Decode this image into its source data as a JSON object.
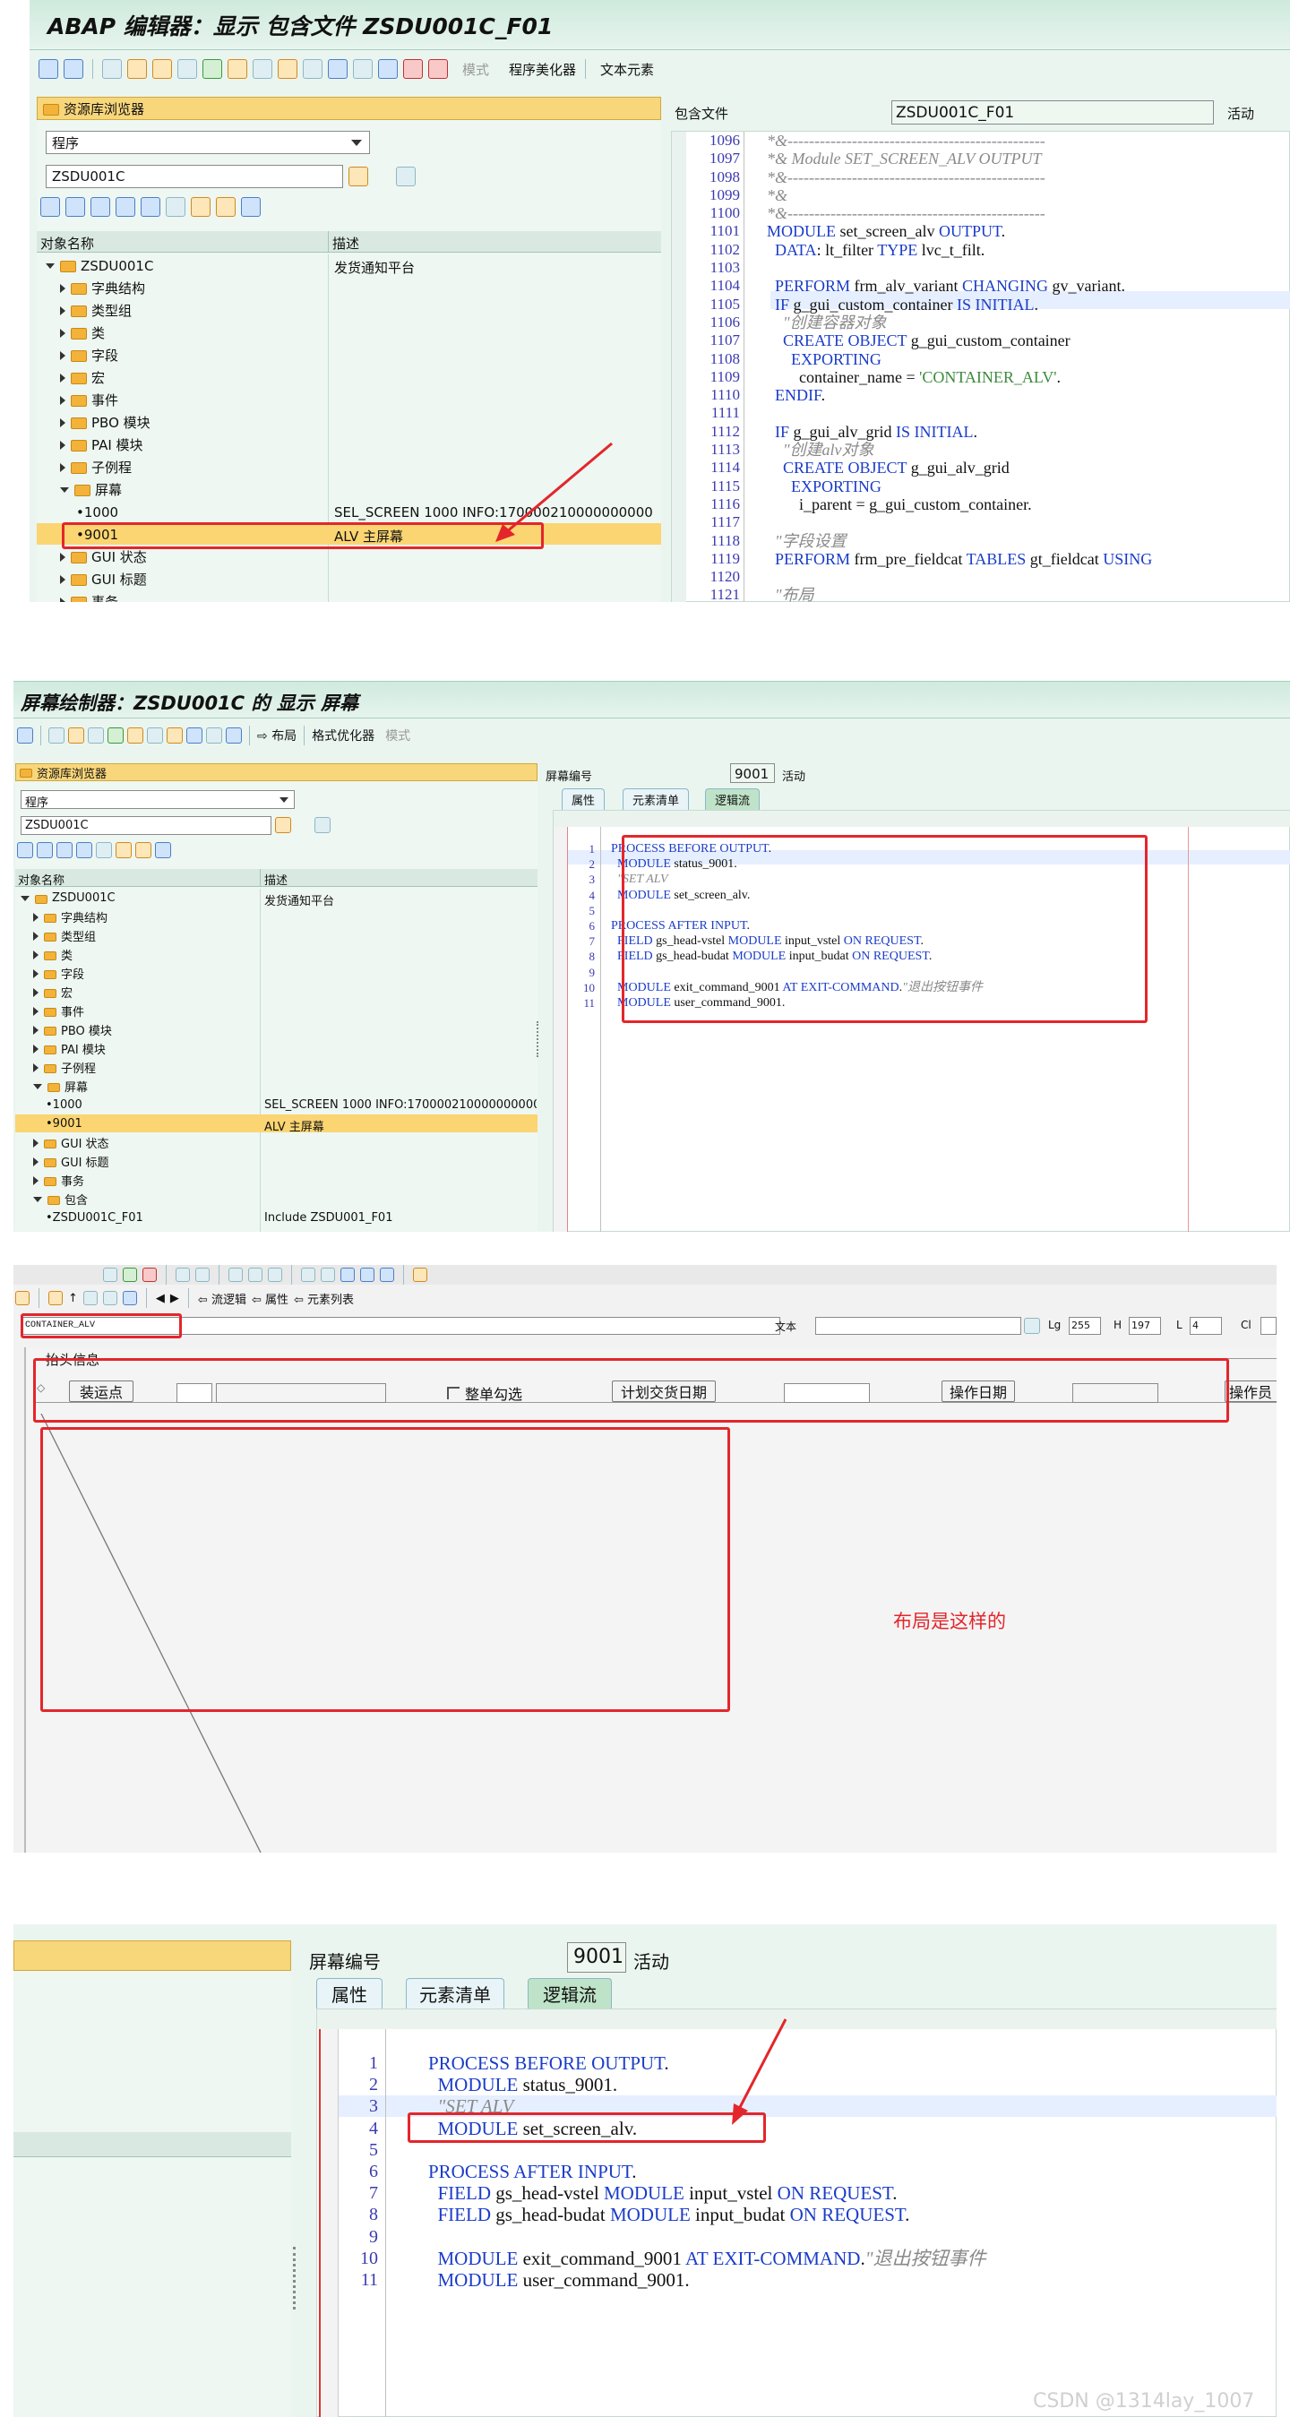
{
  "panel1": {
    "title": "ABAP 编辑器：显示 包含文件 ZSDU001C_F01",
    "toolbar_mode": "模式",
    "toolbar_pretty": "程序美化器",
    "toolbar_text": "文本元素",
    "repo_browser": "资源库浏览器",
    "obj_type": "程序",
    "obj_name": "ZSDU001C",
    "col_name": "对象名称",
    "col_desc": "描述",
    "root": "ZSDU001C",
    "root_desc": "发货通知平台",
    "tree": [
      "字典结构",
      "类型组",
      "类",
      "字段",
      "宏",
      "事件",
      "PBO 模块",
      "PAI 模块",
      "子例程"
    ],
    "screens": "屏幕",
    "screen1": "1000",
    "screen1_desc": "SEL_SCREEN 1000 INFO:170000210000000000",
    "screen2": "9001",
    "screen2_desc": "ALV 主屏幕",
    "tree_more": [
      "GUI 状态",
      "GUI 标题",
      "事务"
    ],
    "include_label": "包含文件",
    "include_value": "ZSDU001C_F01",
    "status": "活动",
    "line_numbers": [
      "1096",
      "1097",
      "1098",
      "1099",
      "1100",
      "1101",
      "1102",
      "1103",
      "1104",
      "1105",
      "1106",
      "1107",
      "1108",
      "1109",
      "1110",
      "1111",
      "1112",
      "1113",
      "1114",
      "1115",
      "1116",
      "1117",
      "1118",
      "1119",
      "1120",
      "1121"
    ],
    "code": [
      "*&------------------------------------------------",
      "*& Module SET_SCREEN_ALV OUTPUT",
      "*&------------------------------------------------",
      "*&",
      "*&------------------------------------------------",
      "MODULE set_screen_alv OUTPUT.",
      "  DATA: lt_filter TYPE lvc_t_filt.",
      "",
      "  PERFORM frm_alv_variant CHANGING gv_variant.",
      "  IF g_gui_custom_container IS INITIAL.",
      "    \"创建容器对象",
      "    CREATE OBJECT g_gui_custom_container",
      "      EXPORTING",
      "        container_name = 'CONTAINER_ALV'.",
      "  ENDIF.",
      "",
      "  IF g_gui_alv_grid IS INITIAL.",
      "    \"创建alv对象",
      "    CREATE OBJECT g_gui_alv_grid",
      "      EXPORTING",
      "        i_parent = g_gui_custom_container.",
      "",
      "  \"字段设置",
      "  PERFORM frm_pre_fieldcat TABLES gt_fieldcat USING",
      "",
      "  \"布局"
    ]
  },
  "panel2": {
    "title": "屏幕绘制器：ZSDU001C 的 显示 屏幕",
    "toolbar_layout": "布局",
    "toolbar_format": "格式优化器",
    "toolbar_mode": "模式",
    "repo_browser": "资源库浏览器",
    "obj_type": "程序",
    "obj_name": "ZSDU001C",
    "col_name": "对象名称",
    "col_desc": "描述",
    "root": "ZSDU001C",
    "root_desc": "发货通知平台",
    "tree": [
      "字典结构",
      "类型组",
      "类",
      "字段",
      "宏",
      "事件",
      "PBO 模块",
      "PAI 模块",
      "子例程"
    ],
    "screens": "屏幕",
    "screen1": "1000",
    "screen1_desc": "SEL_SCREEN 1000 INFO:170000210000000000",
    "screen2": "9001",
    "screen2_desc": "ALV 主屏幕",
    "tree_more": [
      "GUI 状态",
      "GUI 标题",
      "事务"
    ],
    "includes": "包含",
    "include_file": "ZSDU001C_F01",
    "include_desc": "Include ZSDU001_F01",
    "screen_no_label": "屏幕编号",
    "screen_no": "9001",
    "status": "活动",
    "tabs": [
      "属性",
      "元素清单",
      "逻辑流"
    ],
    "line_numbers": [
      "1",
      "2",
      "3",
      "4",
      "5",
      "6",
      "7",
      "8",
      "9",
      "10",
      "11"
    ],
    "code": [
      "PROCESS BEFORE OUTPUT.",
      "  MODULE status_9001.",
      "  \"SET ALV",
      "  MODULE set_screen_alv.",
      "",
      "PROCESS AFTER INPUT.",
      "  FIELD gs_head-vstel MODULE input_vstel ON REQUEST.",
      "  FIELD gs_head-budat MODULE input_budat ON REQUEST.",
      "",
      "  MODULE exit_command_9001 AT EXIT-COMMAND.\"退出按钮事件",
      "  MODULE user_command_9001."
    ]
  },
  "panel3": {
    "nav_flow": "流逻辑",
    "nav_attr": "属性",
    "nav_elements": "元素列表",
    "element_name": "CONTAINER_ALV",
    "text_label": "文本",
    "lg_label": "Lg",
    "lg_value": "255",
    "h_label": "H",
    "h_value": "197",
    "l_label": "L",
    "l_value": "4",
    "cl_label": "Cl",
    "frame_title": "抬头信息",
    "btn_ship": "装运点",
    "chk_all": "整单勾选",
    "btn_plan_date": "计划交货日期",
    "btn_op_date": "操作日期",
    "btn_operator": "操作员",
    "annotation": "布局是这样的"
  },
  "panel4": {
    "screen_no_label": "屏幕编号",
    "screen_no": "9001",
    "status": "活动",
    "tabs": [
      "属性",
      "元素清单",
      "逻辑流"
    ],
    "line_numbers": [
      "1",
      "2",
      "3",
      "4",
      "5",
      "6",
      "7",
      "8",
      "9",
      "10",
      "11"
    ],
    "code": [
      "PROCESS BEFORE OUTPUT.",
      "  MODULE status_9001.",
      "  \"SET ALV",
      "  MODULE set_screen_alv.",
      "",
      "PROCESS AFTER INPUT.",
      "  FIELD gs_head-vstel MODULE input_vstel ON REQUEST.",
      "  FIELD gs_head-budat MODULE input_budat ON REQUEST.",
      "",
      "  MODULE exit_command_9001 AT EXIT-COMMAND.\"退出按钮事件",
      "  MODULE user_command_9001."
    ],
    "footer": "CSDN @1314lay_1007"
  }
}
